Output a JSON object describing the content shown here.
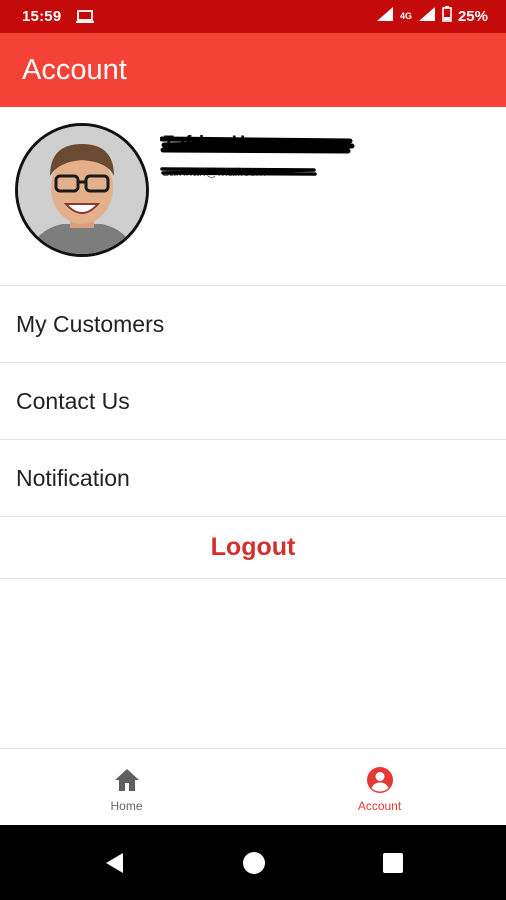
{
  "status_bar": {
    "time": "15:59",
    "network": "4G",
    "battery": "25%"
  },
  "app_bar": {
    "title": "Account"
  },
  "profile": {
    "name": "Zafrina Hassan",
    "email": "zafrinah@mail.com"
  },
  "menu": {
    "items": [
      {
        "label": "My Customers"
      },
      {
        "label": "Contact Us"
      },
      {
        "label": "Notification"
      }
    ],
    "logout": "Logout"
  },
  "bottom_nav": {
    "items": [
      {
        "label": "Home",
        "icon": "home-icon",
        "active": false
      },
      {
        "label": "Account",
        "icon": "account-circle-icon",
        "active": true
      }
    ]
  },
  "colors": {
    "status_bar": "#c50a0a",
    "app_bar": "#f44336",
    "accent": "#e53935",
    "logout": "#d32f2f"
  }
}
